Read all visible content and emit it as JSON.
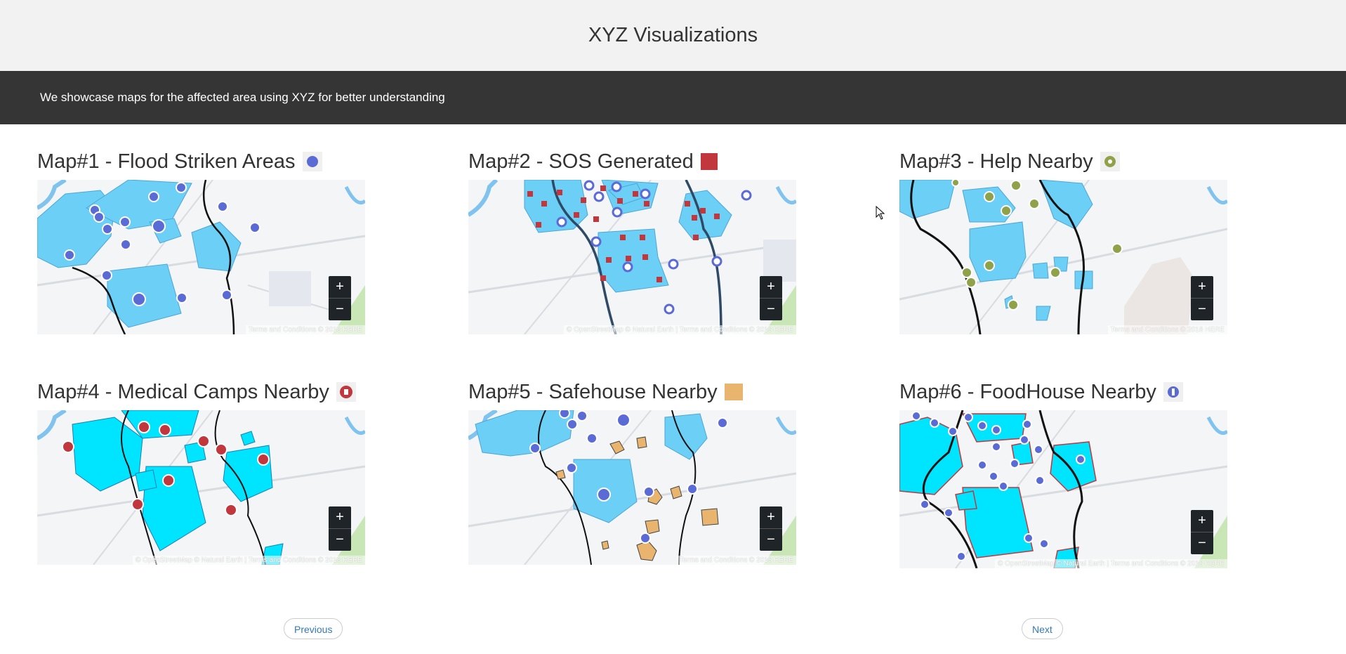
{
  "header": {
    "title": "XYZ Visualizations"
  },
  "banner": {
    "text": "We showcase maps for the affected area using XYZ for better understanding"
  },
  "maps": [
    {
      "title": "Map#1 - Flood Striken Areas",
      "legend_icon": "blue-circle-icon",
      "attribution": "Terms and Conditions © 2018 HERE",
      "zoom_in": "+",
      "zoom_out": "−"
    },
    {
      "title": "Map#2 - SOS Generated",
      "legend_icon": "red-square-icon",
      "attribution": "© OpenStreetMap © Natural Earth | Terms and Conditions © 2018 HERE",
      "zoom_in": "+",
      "zoom_out": "−"
    },
    {
      "title": "Map#3 - Help Nearby",
      "legend_icon": "green-help-icon",
      "attribution": "Terms and Conditions © 2018 HERE",
      "zoom_in": "+",
      "zoom_out": "−"
    },
    {
      "title": "Map#4 - Medical Camps Nearby",
      "legend_icon": "red-medical-icon",
      "attribution": "© OpenStreetMap © Natural Earth | Terms and Conditions © 2018 HERE",
      "zoom_in": "+",
      "zoom_out": "−"
    },
    {
      "title": "Map#5 - Safehouse Nearby",
      "legend_icon": "orange-square-icon",
      "attribution": "Terms and Conditions © 2018 HERE",
      "zoom_in": "+",
      "zoom_out": "−"
    },
    {
      "title": "Map#6 - FoodHouse Nearby",
      "legend_icon": "food-fork-icon",
      "attribution": "© OpenStreetMap © Natural Earth | Terms and Conditions © 2018 HERE",
      "zoom_in": "+",
      "zoom_out": "−"
    }
  ],
  "pager": {
    "previous": "Previous",
    "next": "Next"
  },
  "colors": {
    "flood_fill": "#6ccff6",
    "flood_fill_strong": "#00e5ff",
    "marker_blue": "#5b6bd6",
    "sos_red": "#c1373d",
    "help_green": "#8fa24a",
    "safehouse_orange": "#e8b46e",
    "topbar": "#f2f2f2",
    "banner": "#353535",
    "link": "#337ab7"
  }
}
